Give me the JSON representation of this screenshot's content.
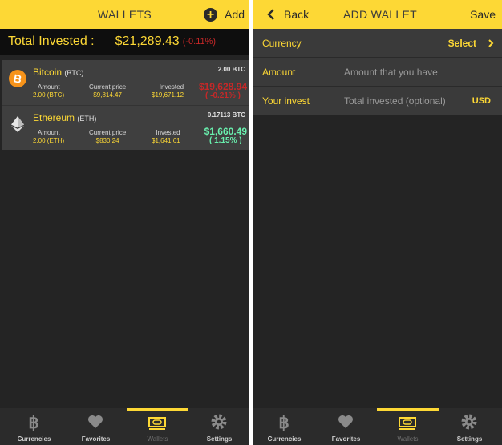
{
  "left": {
    "header": {
      "title": "WALLETS",
      "add_label": "Add"
    },
    "total": {
      "label": "Total Invested :",
      "value": "$21,289.43",
      "change": "(-0.11%)"
    },
    "wallets": [
      {
        "name": "Bitcoin",
        "symbol": "(BTC)",
        "icon": "bitcoin-icon",
        "holding": "2.00 BTC",
        "amount_label": "Amount",
        "amount": "2.00 (BTC)",
        "price_label": "Current price",
        "price": "$9,814.47",
        "invested_label": "Invested",
        "invested": "$19,671.12",
        "current_value": "$19,628.94",
        "change": "( -0.21% )",
        "trend": "negative"
      },
      {
        "name": "Ethereum",
        "symbol": "(ETH)",
        "icon": "ethereum-icon",
        "holding": "0.17113 BTC",
        "amount_label": "Amount",
        "amount": "2.00 (ETH)",
        "price_label": "Current price",
        "price": "$830.24",
        "invested_label": "Invested",
        "invested": "$1,641.61",
        "current_value": "$1,660.49",
        "change": "( 1.15% )",
        "trend": "positive"
      }
    ]
  },
  "right": {
    "header": {
      "back_label": "Back",
      "title": "ADD WALLET",
      "save_label": "Save"
    },
    "form": {
      "currency_label": "Currency",
      "currency_value": "Select",
      "amount_label": "Amount",
      "amount_placeholder": "Amount that you have",
      "invest_label": "Your invest",
      "invest_placeholder": "Total invested (optional)",
      "invest_unit": "USD"
    }
  },
  "nav": {
    "items": [
      {
        "label": "Currencies",
        "icon": "bitcoin-icon"
      },
      {
        "label": "Favorites",
        "icon": "heart-icon"
      },
      {
        "label": "Wallets",
        "icon": "wallet-icon"
      },
      {
        "label": "Settings",
        "icon": "gear-icon"
      }
    ],
    "active": "Wallets"
  },
  "colors": {
    "accent": "#fdd835",
    "background": "#242424",
    "card": "#3f3f3f",
    "negative": "#c62828",
    "positive": "#69f0ae",
    "btc_orange": "#f7931a"
  }
}
